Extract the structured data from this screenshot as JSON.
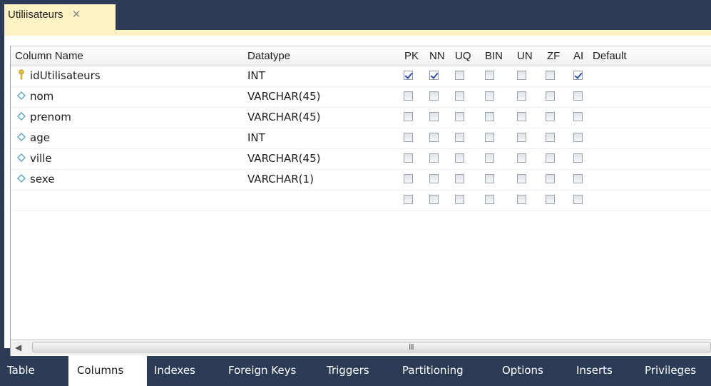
{
  "document_tab": {
    "title": "Utiliisateurs",
    "close": "✕"
  },
  "grid": {
    "headers": {
      "column_name": "Column Name",
      "datatype": "Datatype",
      "pk": "PK",
      "nn": "NN",
      "uq": "UQ",
      "bin": "BIN",
      "un": "UN",
      "zf": "ZF",
      "ai": "AI",
      "default": "Default"
    },
    "rows": [
      {
        "name": "idUtilisateurs",
        "type": "INT",
        "icon": "key-icon",
        "flags": {
          "pk": true,
          "nn": true,
          "uq": false,
          "bin": false,
          "un": false,
          "zf": false,
          "ai": true
        }
      },
      {
        "name": "nom",
        "type": "VARCHAR(45)",
        "icon": "column-diamond-icon",
        "flags": {
          "pk": false,
          "nn": false,
          "uq": false,
          "bin": false,
          "un": false,
          "zf": false,
          "ai": false
        }
      },
      {
        "name": "prenom",
        "type": "VARCHAR(45)",
        "icon": "column-diamond-icon",
        "flags": {
          "pk": false,
          "nn": false,
          "uq": false,
          "bin": false,
          "un": false,
          "zf": false,
          "ai": false
        }
      },
      {
        "name": "age",
        "type": "INT",
        "icon": "column-diamond-icon",
        "flags": {
          "pk": false,
          "nn": false,
          "uq": false,
          "bin": false,
          "un": false,
          "zf": false,
          "ai": false
        }
      },
      {
        "name": "ville",
        "type": "VARCHAR(45)",
        "icon": "column-diamond-icon",
        "flags": {
          "pk": false,
          "nn": false,
          "uq": false,
          "bin": false,
          "un": false,
          "zf": false,
          "ai": false
        }
      },
      {
        "name": "sexe",
        "type": "VARCHAR(1)",
        "icon": "column-diamond-icon",
        "flags": {
          "pk": false,
          "nn": false,
          "uq": false,
          "bin": false,
          "un": false,
          "zf": false,
          "ai": false
        }
      },
      {
        "name": "",
        "type": "",
        "icon": "",
        "flags": {
          "pk": false,
          "nn": false,
          "uq": false,
          "bin": false,
          "un": false,
          "zf": false,
          "ai": false
        }
      }
    ]
  },
  "scrollbar": {
    "left_arrow": "◀",
    "grip": "III"
  },
  "bottom_tabs": {
    "active": "Columns",
    "items": [
      "Table",
      "Columns",
      "Indexes",
      "Foreign Keys",
      "Triggers",
      "Partitioning",
      "Options",
      "Inserts",
      "Privileges"
    ]
  },
  "colors": {
    "chrome": "#2b3a55",
    "active_tab": "#fdf2c4",
    "check": "#2b4fa8"
  }
}
